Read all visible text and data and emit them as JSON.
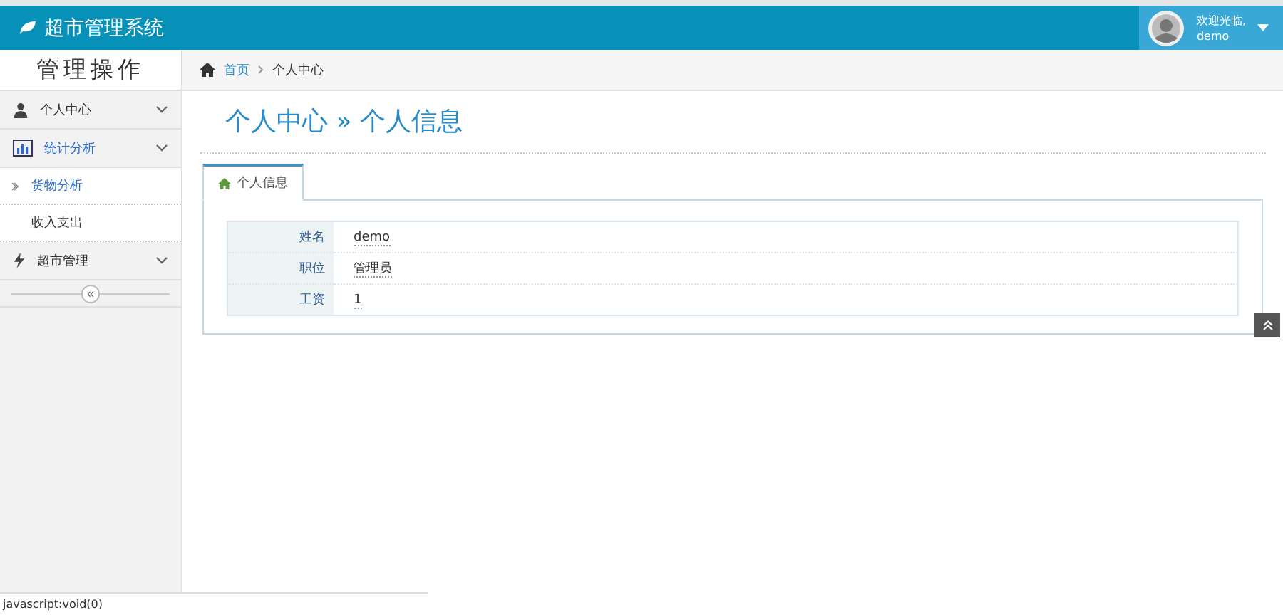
{
  "header": {
    "title": "超市管理系统",
    "welcome": "欢迎光临,",
    "user": "demo"
  },
  "sidebar": {
    "title": "管理操作",
    "items": [
      {
        "label": "个人中心",
        "kind": "user",
        "expanded": false
      },
      {
        "label": "统计分析",
        "kind": "chart",
        "expanded": true,
        "children": [
          {
            "label": "货物分析",
            "selected": true
          },
          {
            "label": "收入支出",
            "selected": false
          }
        ]
      },
      {
        "label": "超市管理",
        "kind": "bolt",
        "expanded": false
      }
    ],
    "collapse": "«"
  },
  "breadcrumb": [
    "首页",
    "个人中心"
  ],
  "page_title": {
    "section": "个人中心",
    "separator": "»",
    "page": "个人信息"
  },
  "tabs": [
    {
      "label": "个人信息",
      "selected": true
    }
  ],
  "info": [
    {
      "label": "姓名",
      "value": "demo"
    },
    {
      "label": "职位",
      "value": "管理员"
    },
    {
      "label": "工资",
      "value": "1"
    }
  ],
  "status_bar": "javascript:void(0)"
}
